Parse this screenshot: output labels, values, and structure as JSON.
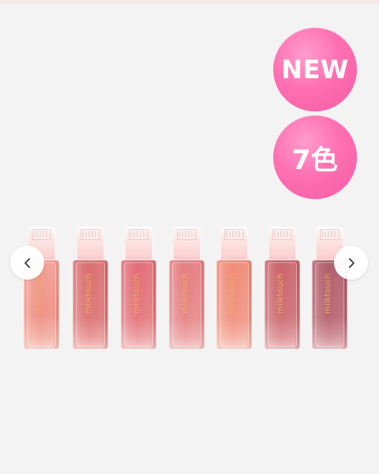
{
  "badges": {
    "new": "NEW",
    "colors": "7色"
  },
  "navigation": {
    "previous": "‹",
    "next": "›",
    "previous_icon": "chevron-left-icon",
    "next_icon": "chevron-right-icon"
  },
  "products": [
    {
      "brand": "milktouch",
      "shade": "#ef8e82"
    },
    {
      "brand": "milktouch",
      "shade": "#dd7475"
    },
    {
      "brand": "milktouch",
      "shade": "#e5777d"
    },
    {
      "brand": "milktouch",
      "shade": "#e78688"
    },
    {
      "brand": "milktouch",
      "shade": "#f19280"
    },
    {
      "brand": "milktouch",
      "shade": "#ce6d72"
    },
    {
      "brand": "milktouch",
      "shade": "#b86570"
    }
  ],
  "colors": {
    "background": "#f3f3f3",
    "badge_pink": "#ff70b2",
    "brand_gold": "#ecb162"
  }
}
